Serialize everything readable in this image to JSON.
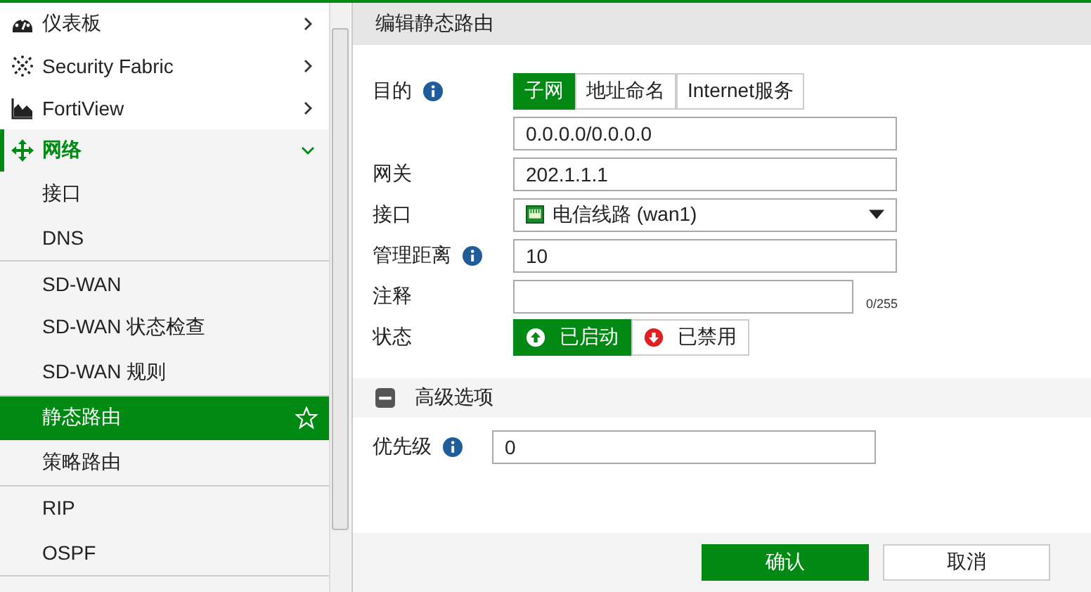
{
  "sidebar": {
    "items": [
      {
        "label": "仪表板",
        "expanded": false,
        "selected": false
      },
      {
        "label": "Security Fabric",
        "expanded": false,
        "selected": false
      },
      {
        "label": "FortiView",
        "expanded": false,
        "selected": false
      },
      {
        "label": "网络",
        "expanded": true,
        "selected": true,
        "groups": [
          {
            "items": [
              {
                "label": "接口",
                "selected": false
              },
              {
                "label": "DNS",
                "selected": false
              }
            ]
          },
          {
            "items": [
              {
                "label": "SD-WAN",
                "selected": false
              },
              {
                "label": "SD-WAN 状态检查",
                "selected": false
              },
              {
                "label": "SD-WAN 规则",
                "selected": false
              }
            ]
          },
          {
            "items": [
              {
                "label": "静态路由",
                "selected": true
              },
              {
                "label": "策略路由",
                "selected": false
              }
            ]
          },
          {
            "items": [
              {
                "label": "RIP",
                "selected": false
              },
              {
                "label": "OSPF",
                "selected": false
              }
            ]
          }
        ]
      }
    ]
  },
  "panel": {
    "title": "编辑静态路由",
    "rows": [
      {
        "label": "目的",
        "info": true,
        "kind": "tabs",
        "tabs": [
          {
            "label": "子网",
            "selected": true
          },
          {
            "label": "地址命名",
            "selected": false
          },
          {
            "label": "Internet服务",
            "selected": false
          }
        ]
      },
      {
        "info": false,
        "kind": "text",
        "value": "0.0.0.0/0.0.0.0"
      },
      {
        "label": "网关",
        "info": false,
        "kind": "text",
        "value": "202.1.1.1"
      },
      {
        "label": "接口",
        "info": false,
        "kind": "select",
        "value": "电信线路 (wan1)"
      },
      {
        "label": "管理距离",
        "info": true,
        "kind": "text",
        "value": "10"
      },
      {
        "label": "注释",
        "info": false,
        "kind": "textarea",
        "counter": "0/255"
      },
      {
        "label": "状态",
        "info": false,
        "kind": "toggle",
        "options": [
          {
            "label": "已启动",
            "selected": true
          },
          {
            "label": "已禁用",
            "selected": false
          }
        ]
      }
    ],
    "advanced": {
      "title": "高级选项",
      "expanded": true,
      "rows": [
        {
          "label": "优先级",
          "info": true,
          "value": "0"
        }
      ]
    },
    "buttons": [
      {
        "label": "确认",
        "primary": true
      },
      {
        "label": "取消",
        "primary": false
      }
    ]
  }
}
